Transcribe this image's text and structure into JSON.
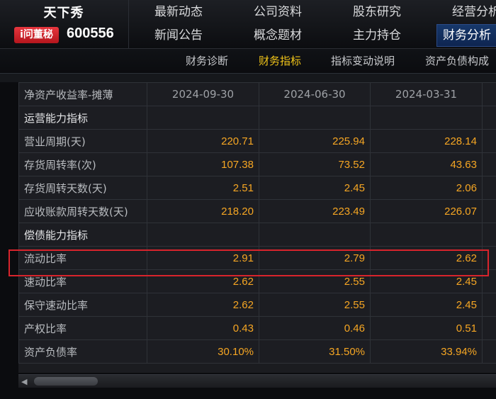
{
  "stock": {
    "name": "天下秀",
    "tag": "i问董秘",
    "code": "600556"
  },
  "top_nav": {
    "row1": [
      "最新动态",
      "公司资料",
      "股东研究",
      "经营分析"
    ],
    "row2": [
      "新闻公告",
      "概念题材",
      "主力持仓",
      "财务分析"
    ],
    "active": "财务分析"
  },
  "sub_nav": {
    "items": [
      "财务诊断",
      "财务指标",
      "指标变动说明",
      "资产负债构成"
    ],
    "active": "财务指标"
  },
  "table": {
    "header_label": "净资产收益率-摊薄",
    "columns": [
      "2024-09-30",
      "2024-06-30",
      "2024-03-31"
    ],
    "rows": [
      {
        "label": "运营能力指标",
        "values": [
          "",
          "",
          ""
        ]
      },
      {
        "label": "营业周期(天)",
        "values": [
          "220.71",
          "225.94",
          "228.14"
        ]
      },
      {
        "label": "存货周转率(次)",
        "values": [
          "107.38",
          "73.52",
          "43.63"
        ]
      },
      {
        "label": "存货周转天数(天)",
        "values": [
          "2.51",
          "2.45",
          "2.06"
        ]
      },
      {
        "label": "应收账款周转天数(天)",
        "values": [
          "218.20",
          "223.49",
          "226.07"
        ]
      },
      {
        "label": "偿债能力指标",
        "values": [
          "",
          "",
          ""
        ]
      },
      {
        "label": "流动比率",
        "values": [
          "2.91",
          "2.79",
          "2.62"
        ]
      },
      {
        "label": "速动比率",
        "values": [
          "2.62",
          "2.55",
          "2.45"
        ]
      },
      {
        "label": "保守速动比率",
        "values": [
          "2.62",
          "2.55",
          "2.45"
        ]
      },
      {
        "label": "产权比率",
        "values": [
          "0.43",
          "0.46",
          "0.51"
        ]
      },
      {
        "label": "资产负债率",
        "values": [
          "30.10%",
          "31.50%",
          "33.94%"
        ]
      }
    ]
  },
  "colors": {
    "value": "#f6a623",
    "active_sub": "#f0c419",
    "highlight": "#d8242c",
    "tag_bg": "#e7363e"
  }
}
